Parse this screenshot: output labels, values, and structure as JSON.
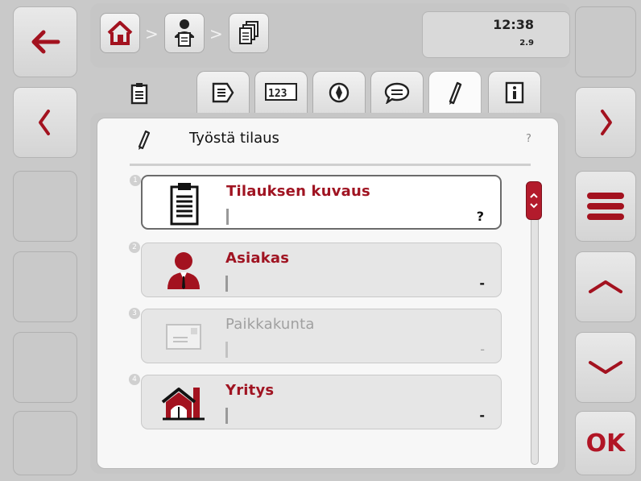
{
  "header": {
    "time": "12:38",
    "speed": "2.9",
    "breadcrumb_sep": ">"
  },
  "panel": {
    "title": "Työstä tilaus",
    "help": "?"
  },
  "rows": [
    {
      "num": "1",
      "label": "Tilauksen kuvaus",
      "value": "?"
    },
    {
      "num": "2",
      "label": "Asiakas",
      "value": "-"
    },
    {
      "num": "3",
      "label": "Paikkakunta",
      "value": "-"
    },
    {
      "num": "4",
      "label": "Yritys",
      "value": "-"
    }
  ],
  "right_buttons": {
    "ok_label": "OK"
  },
  "colors": {
    "accent": "#a01422",
    "panel_bg": "#f7f7f7"
  }
}
